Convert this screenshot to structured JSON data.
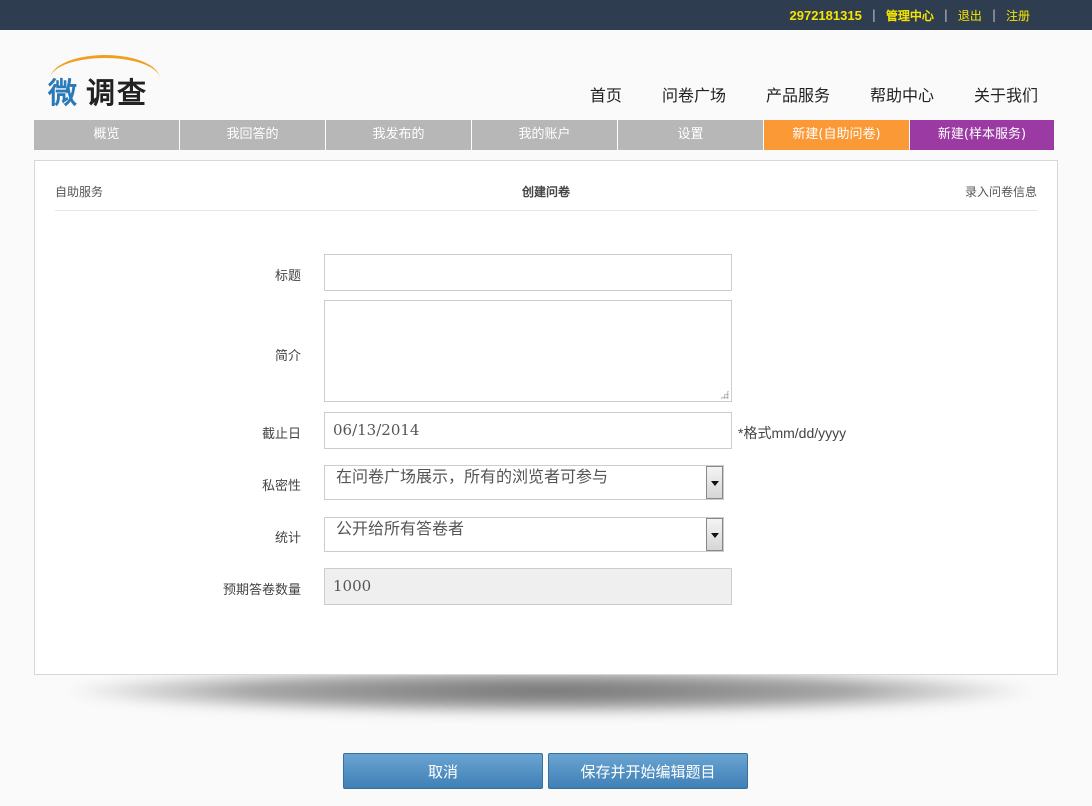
{
  "topbar": {
    "user_id": "2972181315",
    "links": [
      "管理中心",
      "退出",
      "注册"
    ],
    "sep": "|"
  },
  "logo": {
    "char1": "微",
    "char2": "调查"
  },
  "main_nav": [
    "首页",
    "问卷广场",
    "产品服务",
    "帮助中心",
    "关于我们"
  ],
  "tabs": [
    "概览",
    "我回答的",
    "我发布的",
    "我的账户",
    "设置",
    "新建(自助问卷)",
    "新建(样本服务)"
  ],
  "panel": {
    "left_label": "自助服务",
    "title": "创建问卷",
    "right_label": "录入问卷信息"
  },
  "form": {
    "title_label": "标题",
    "title_value": "",
    "intro_label": "简介",
    "deadline_label": "截止日",
    "deadline_value": "06/13/2014",
    "deadline_hint": "*格式mm/dd/yyyy",
    "privacy_label": "私密性",
    "privacy_value": "在问卷广场展示，所有的浏览者可参与",
    "stats_label": "统计",
    "stats_value": "公开给所有答卷者",
    "expected_label": "预期答卷数量",
    "expected_value": "1000"
  },
  "buttons": {
    "cancel": "取消",
    "save": "保存并开始编辑题目"
  },
  "colors": {
    "topbar": "#2e3e50",
    "link": "#f6e500",
    "tab_gray": "#b7b7b7",
    "tab_orange": "#fb9937",
    "tab_purple": "#9b3aa3",
    "button": "#4a8cc3"
  }
}
